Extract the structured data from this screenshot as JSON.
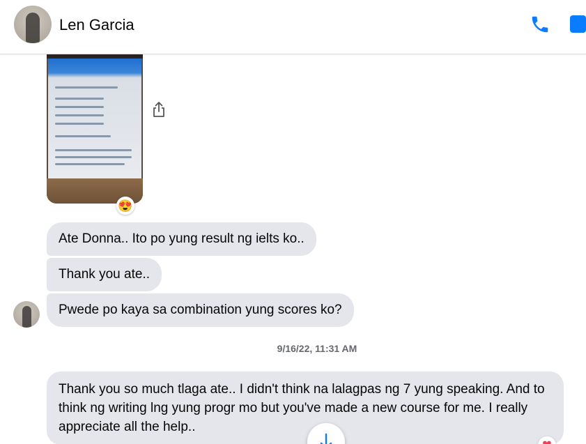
{
  "header": {
    "contact_name": "Len Garcia",
    "accent_color": "#0a7cff"
  },
  "icons": {
    "call": "phone-icon",
    "video": "video-icon",
    "share": "share-icon",
    "scroll_down": "arrow-down-icon"
  },
  "messages": {
    "photo_reaction": "😍",
    "m1": "Ate Donna.. Ito po yung result ng ielts ko..",
    "m2": "Thank you ate..",
    "m3": "Pwede po kaya sa combination yung scores ko?",
    "timestamp": "9/16/22, 11:31 AM",
    "m4": "Thank you so much tlaga ate.. I didn't think na lalagpas ng 7 yung speaking. And to think ng writing lng yung progr mo but you've made a new course for me. I really appreciate all the help..",
    "m4_reaction": "❤"
  }
}
